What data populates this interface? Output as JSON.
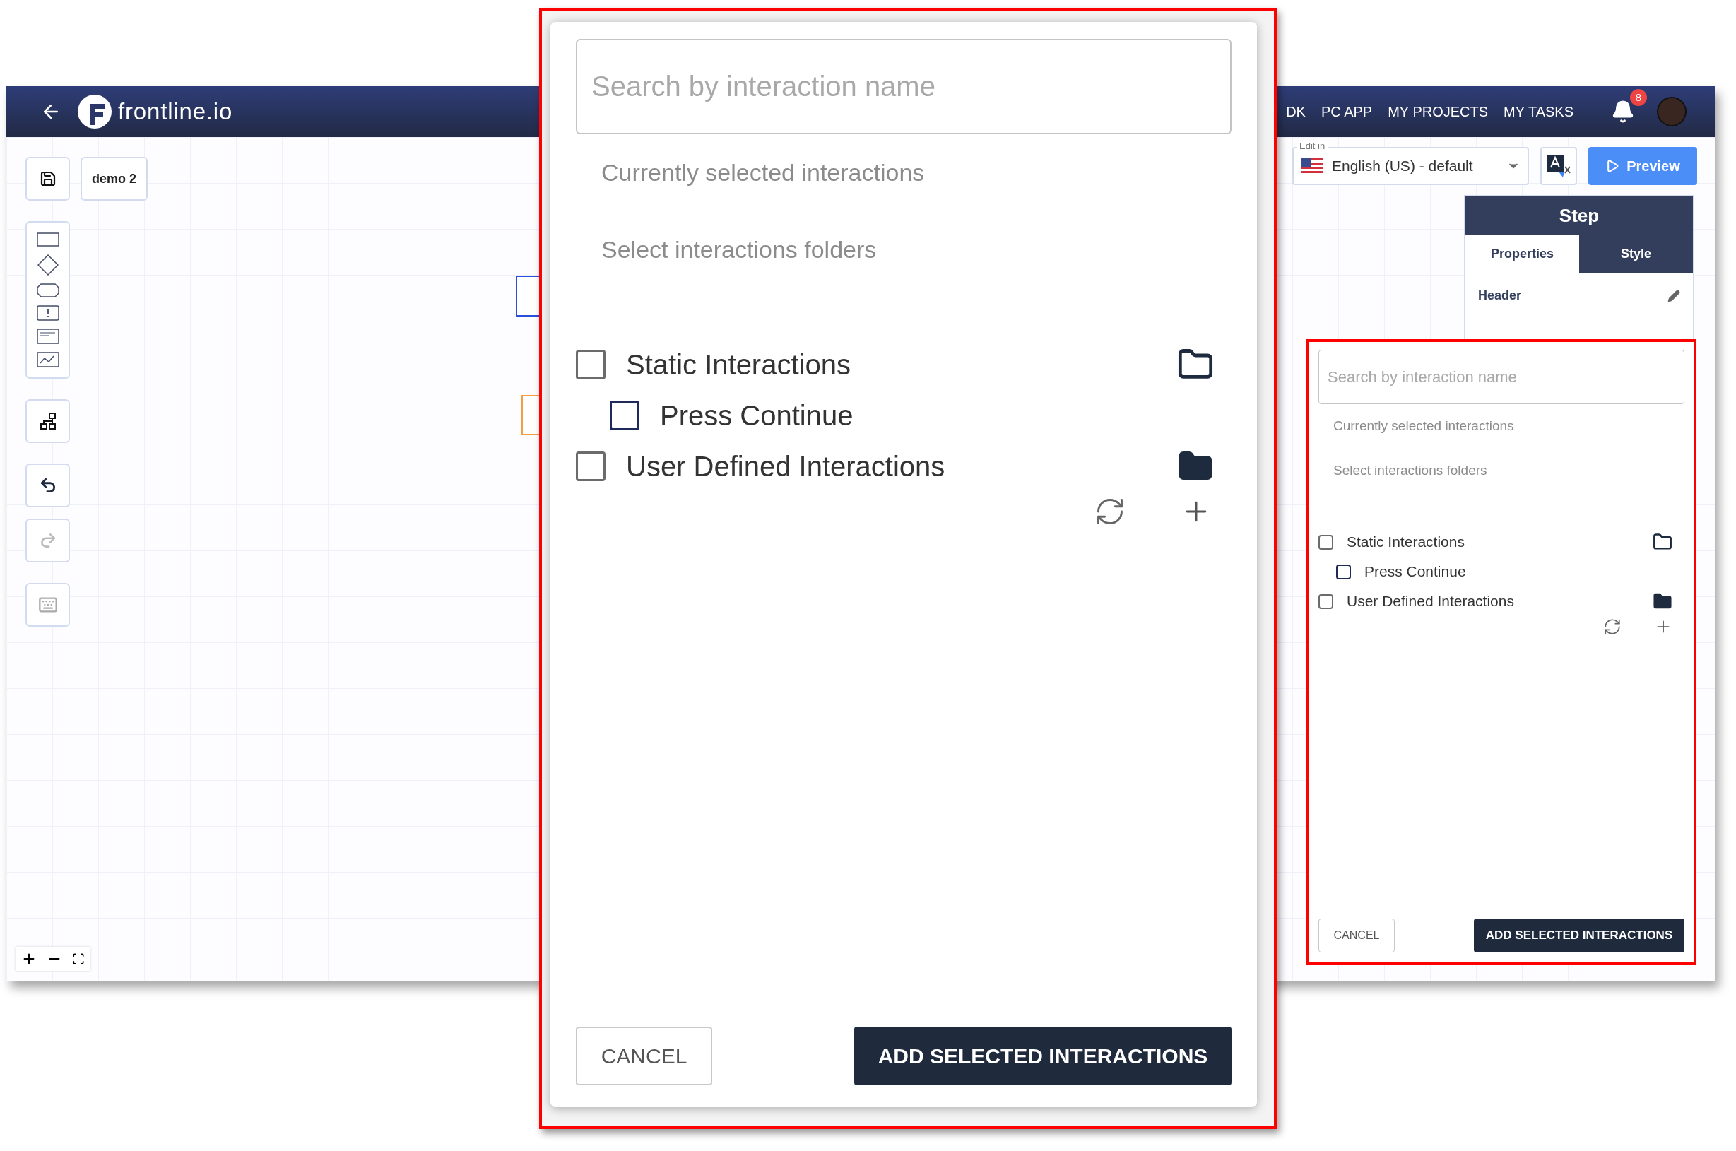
{
  "header": {
    "brand": "frontline.io",
    "nav": [
      "DK",
      "PC APP",
      "MY PROJECTS",
      "MY TASKS"
    ],
    "notification_count": "8"
  },
  "toolbar": {
    "document_name": "demo 2"
  },
  "language": {
    "label": "Edit in",
    "value": "English (US) - default"
  },
  "preview_button": "Preview",
  "step_panel": {
    "title": "Step",
    "tabs": [
      {
        "label": "Properties",
        "selected": true
      },
      {
        "label": "Style",
        "selected": false
      }
    ],
    "header_label": "Header"
  },
  "interaction_dialog_magnified": {
    "placeholder": "Search by interaction name",
    "selected_label": "Currently selected interactions",
    "folders_label": "Select interactions folders",
    "folders": [
      {
        "label": "Static Interactions",
        "checked": false,
        "expanded": true,
        "children": [
          {
            "label": "Press Continue",
            "checked": false
          }
        ]
      },
      {
        "label": "User Defined Interactions",
        "checked": false,
        "expanded": false
      }
    ],
    "cancel_button": "CANCEL",
    "add_button": "ADD SELECTED INTERACTIONS"
  },
  "interaction_dialog": {
    "placeholder": "Search by interaction name",
    "selected_label": "Currently selected interactions",
    "folders_label": "Select interactions folders",
    "folders": [
      {
        "label": "Static Interactions",
        "checked": false,
        "expanded": true,
        "children": [
          {
            "label": "Press Continue",
            "checked": false
          }
        ]
      },
      {
        "label": "User Defined Interactions",
        "checked": false,
        "expanded": false
      }
    ],
    "cancel_button": "CANCEL",
    "add_button": "ADD SELECTED INTERACTIONS"
  }
}
